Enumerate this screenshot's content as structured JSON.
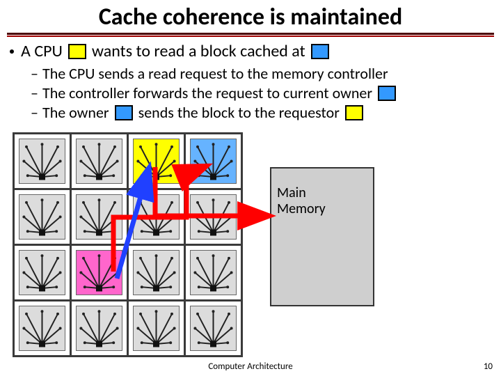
{
  "title": "Cache coherence is maintained",
  "bullet": {
    "seg1": "A CPU",
    "seg2": "wants to read a block cached at"
  },
  "sub_bullets": [
    {
      "text": "The CPU sends a read request to the memory controller"
    },
    {
      "text_pre": "The controller forwards the request to current owner",
      "chip": "blue"
    },
    {
      "text_pre": "The owner",
      "chip_pre": "blue",
      "text_mid": "sends the block to the requestor",
      "chip_post": "yellow"
    }
  ],
  "grid": {
    "rows": 4,
    "cols": 4,
    "highlights": [
      {
        "row": 0,
        "col": 2,
        "color": "yellow"
      },
      {
        "row": 0,
        "col": 3,
        "color": "blue"
      },
      {
        "row": 2,
        "col": 1,
        "color": "pink"
      }
    ]
  },
  "main_memory_label": "Main\nMemory",
  "footer": "Computer Architecture",
  "page_number": "10"
}
